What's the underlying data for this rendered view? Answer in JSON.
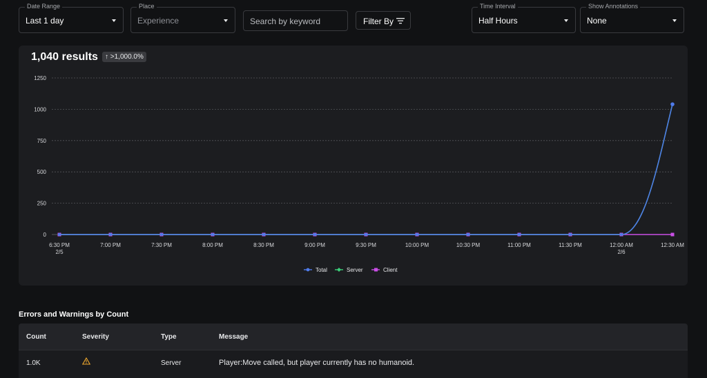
{
  "filters": {
    "date_range": {
      "label": "Date Range",
      "value": "Last 1 day"
    },
    "place": {
      "label": "Place",
      "value": "Experience"
    },
    "search": {
      "placeholder": "Search by keyword"
    },
    "filter_by": {
      "label": "Filter By"
    },
    "time_interval": {
      "label": "Time Interval",
      "value": "Half Hours"
    },
    "show_annotations": {
      "label": "Show Annotations",
      "value": "None"
    }
  },
  "summary": {
    "results": "1,040 results",
    "change_badge": "↑ >1,000.0%"
  },
  "chart_data": {
    "type": "line",
    "categories": [
      "6:30 PM|2/5",
      "7:00 PM",
      "7:30 PM",
      "8:00 PM",
      "8:30 PM",
      "9:00 PM",
      "9:30 PM",
      "10:00 PM",
      "10:30 PM",
      "11:00 PM",
      "11:30 PM",
      "12:00 AM|2/6",
      "12:30 AM"
    ],
    "ylim": [
      0,
      1250
    ],
    "yticks": [
      0,
      250,
      500,
      750,
      1000,
      1250
    ],
    "grid": true,
    "legend_placement": "bottom-center",
    "series": [
      {
        "name": "Total",
        "color": "#4f7bea",
        "values": [
          0,
          0,
          0,
          0,
          0,
          0,
          0,
          0,
          0,
          0,
          0,
          0,
          1040
        ]
      },
      {
        "name": "Server",
        "color": "#3ccf7a",
        "values": [
          0,
          0,
          0,
          0,
          0,
          0,
          0,
          0,
          0,
          0,
          0,
          0,
          1040
        ]
      },
      {
        "name": "Client",
        "color": "#c94ee6",
        "values": [
          0,
          0,
          0,
          0,
          0,
          0,
          0,
          0,
          0,
          0,
          0,
          0,
          0
        ]
      }
    ]
  },
  "table": {
    "title": "Errors and Warnings by Count",
    "headers": [
      "Count",
      "Severity",
      "Type",
      "Message"
    ],
    "rows": [
      {
        "count": "1.0K",
        "severity": "warning-icon",
        "type": "Server",
        "message": "Player:Move called, but player currently has no humanoid."
      }
    ]
  }
}
